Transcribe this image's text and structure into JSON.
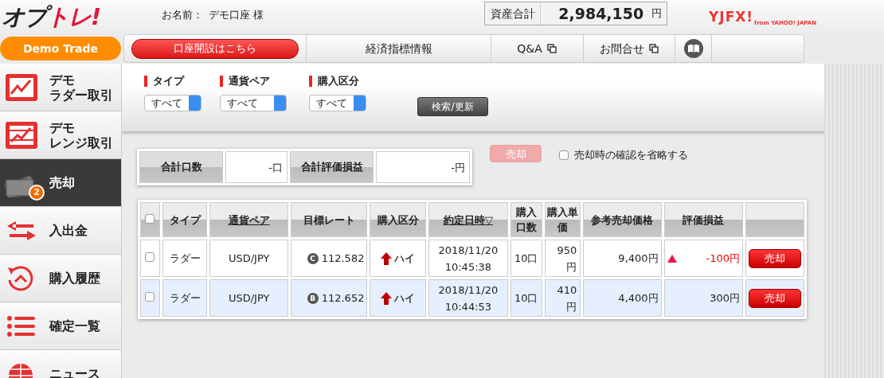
{
  "header": {
    "logo": {
      "dark": "オプ",
      "accent": "トレ!"
    },
    "user_label": "お名前：",
    "user_name": "デモ口座 様",
    "assets": {
      "label": "資産合計",
      "value": "2,984,150",
      "unit": "円"
    },
    "brand": {
      "main": "YJFX!",
      "sub": "from YAHOO! JAPAN"
    }
  },
  "mode_badge": "Demo Trade",
  "nav": [
    {
      "kind": "cta",
      "label": "口座開設はこちら"
    },
    {
      "kind": "text",
      "label": "経済指標情報"
    },
    {
      "kind": "external",
      "label": "Q&A"
    },
    {
      "kind": "external",
      "label": "お問合せ"
    },
    {
      "kind": "book"
    },
    {
      "kind": "blank"
    }
  ],
  "sidebar": {
    "items": [
      {
        "lines": [
          "デモ",
          "ラダー取引"
        ],
        "selected": false
      },
      {
        "lines": [
          "デモ",
          "レンジ取引"
        ],
        "selected": false
      },
      {
        "lines": [
          "売却"
        ],
        "selected": true,
        "badge": "2"
      },
      {
        "lines": [
          "入出金"
        ],
        "selected": false
      },
      {
        "lines": [
          "購入履歴"
        ],
        "selected": false
      },
      {
        "lines": [
          "確定一覧"
        ],
        "selected": false
      },
      {
        "lines": [
          "ニュース"
        ],
        "selected": false
      }
    ]
  },
  "filters": [
    {
      "label": "タイプ",
      "value": "すべて"
    },
    {
      "label": "通貨ペア",
      "value": "すべて"
    },
    {
      "label": "購入区分",
      "value": "すべて"
    }
  ],
  "search_button": "検索/更新",
  "summary": [
    {
      "label": "合計口数",
      "value": "-口"
    },
    {
      "label": "合計評価損益",
      "value": "-円"
    }
  ],
  "bulk_sell": {
    "label": "売却",
    "disabled": true
  },
  "skip_confirm": {
    "label": "売却時の確認を省略する",
    "checked": false
  },
  "table": {
    "select_all": {
      "checked": false
    },
    "columns": [
      {
        "label": "タイプ",
        "link": false
      },
      {
        "label": "通貨ペア",
        "link": true
      },
      {
        "label": "目標レート",
        "link": false
      },
      {
        "label": "購入区分",
        "link": false
      },
      {
        "label": "約定日時▽",
        "link": true
      },
      {
        "label": "購入口数",
        "link": false
      },
      {
        "label": "購入単価",
        "link": false
      },
      {
        "label": "参考売却価格",
        "link": false
      },
      {
        "label": "評価損益",
        "link": false
      }
    ],
    "rows": [
      {
        "checked": false,
        "type": "ラダー",
        "pair": "USD/JPY",
        "rate_mark": "C",
        "rate": "112.582",
        "direction_label": "ハイ",
        "executed": "2018/11/20 10:45:38",
        "quantity": "10口",
        "unit_price": "950円",
        "sell_price": "9,400円",
        "pnl": "-100円",
        "loss": true,
        "action": "売却"
      },
      {
        "checked": false,
        "type": "ラダー",
        "pair": "USD/JPY",
        "rate_mark": "B",
        "rate": "112.652",
        "direction_label": "ハイ",
        "executed": "2018/11/20 10:44:53",
        "quantity": "10口",
        "unit_price": "410円",
        "sell_price": "4,400円",
        "pnl": "300円",
        "loss": false,
        "action": "売却"
      }
    ]
  }
}
